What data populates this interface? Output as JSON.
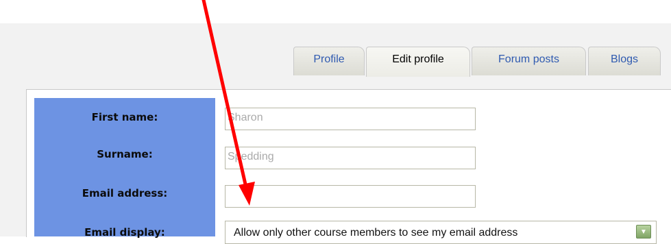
{
  "tabs": [
    {
      "label": "Profile"
    },
    {
      "label": "Edit profile"
    },
    {
      "label": "Forum posts"
    },
    {
      "label": "Blogs"
    }
  ],
  "form": {
    "first_name_label": "First name:",
    "surname_label": "Surname:",
    "email_label": "Email address:",
    "email_display_label": "Email display:",
    "first_name_value": "Sharon",
    "surname_value": "Spedding",
    "email_value": "",
    "email_display_value": "Allow only other course members to see my email address"
  },
  "colors": {
    "label_column": "#6d93e3",
    "annotation_arrow": "#ff0000",
    "tab_link": "#2f5ab0"
  }
}
